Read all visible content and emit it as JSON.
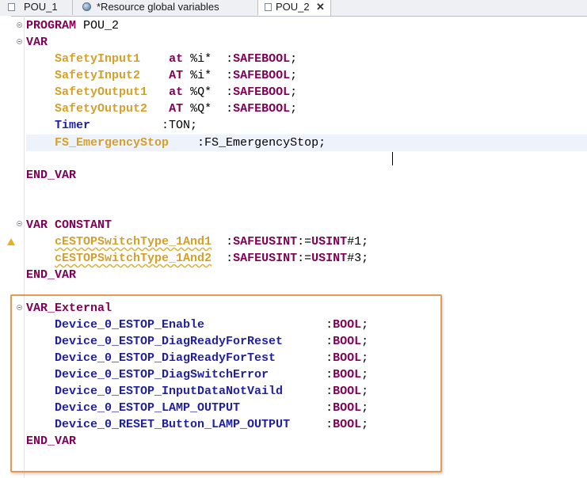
{
  "tabs": [
    {
      "label": "POU_1",
      "icon": "document-icon"
    },
    {
      "label": "*Resource global variables",
      "icon": "globe-icon"
    },
    {
      "label": "POU_2",
      "icon": "document-icon",
      "active": true,
      "close": "✕"
    }
  ],
  "code": {
    "program_kw": "PROGRAM",
    "program_name": " POU_2",
    "var_kw": "VAR",
    "vars": [
      {
        "name": "SafetyInput1",
        "pad": "    ",
        "at": "at",
        "addr": " %i*",
        "colon": "  :",
        "type": "SAFEBOOL",
        "semi": ";"
      },
      {
        "name": "SafetyInput2",
        "pad": "    ",
        "at": "AT",
        "addr": " %i*",
        "colon": "  :",
        "type": "SAFEBOOL",
        "semi": ";"
      },
      {
        "name": "SafetyOutput1",
        "pad": "   ",
        "at": "at",
        "addr": " %Q*",
        "colon": "  :",
        "type": "SAFEBOOL",
        "semi": ";"
      },
      {
        "name": "SafetyOutput2",
        "pad": "   ",
        "at": "AT",
        "addr": " %Q*",
        "colon": "  :",
        "type": "SAFEBOOL",
        "semi": ";"
      }
    ],
    "timer": {
      "name": "Timer",
      "rest": "          :TON;"
    },
    "estop": {
      "name": "FS_EmergencyStop",
      "rest": "    :FS_EmergencyStop;"
    },
    "end_var": "END_VAR",
    "var_constant": "VAR CONSTANT",
    "constants": [
      {
        "name": "cESTOPSwitchType_1And1",
        "colon": "  :",
        "type": "SAFEUSINT",
        "assign": ":=",
        "lit": "USINT",
        "value": "#1;"
      },
      {
        "name": "cESTOPSwitchType_1And2",
        "colon": "  :",
        "type": "SAFEUSINT",
        "assign": ":=",
        "lit": "USINT",
        "value": "#3;"
      }
    ],
    "var_external": "VAR_External",
    "externals": [
      {
        "name": "Device_0_ESTOP_Enable",
        "pad": "                 ",
        "type": "BOOL"
      },
      {
        "name": "Device_0_ESTOP_DiagReadyForReset",
        "pad": "      ",
        "type": "BOOL"
      },
      {
        "name": "Device_0_ESTOP_DiagReadyForTest",
        "pad": "       ",
        "type": "BOOL"
      },
      {
        "name": "Device_0_ESTOP_DiagSwitchError",
        "pad": "        ",
        "type": "BOOL"
      },
      {
        "name": "Device_0_ESTOP_InputDataNotVaild",
        "pad": "      ",
        "type": "BOOL"
      },
      {
        "name": "Device_0_ESTOP_LAMP_OUTPUT",
        "pad": "            ",
        "type": "BOOL"
      },
      {
        "name": "Device_0_RESET_Button_LAMP_OUTPUT",
        "pad": "     ",
        "type": "BOOL"
      }
    ],
    "colon": ":",
    "semi": ";"
  },
  "colors": {
    "keyword": "#7f0055",
    "global_var": "#d4a02a",
    "local_var": "#1f1fa0",
    "highlight_box": "#e39a56"
  }
}
